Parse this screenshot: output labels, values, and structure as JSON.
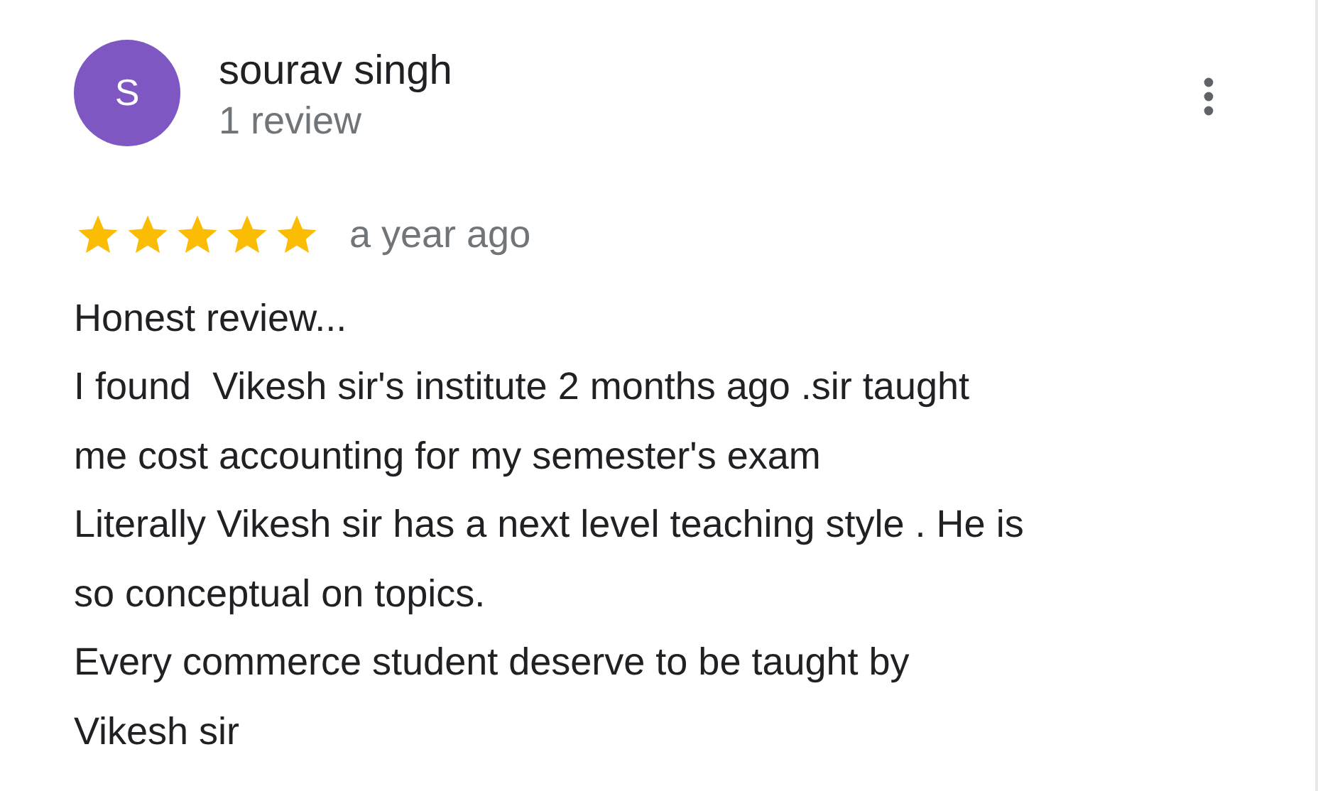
{
  "review": {
    "avatar_letter": "S",
    "author": "sourav singh",
    "review_count": "1 review",
    "stars": 5,
    "time": "a year ago",
    "lines": [
      "Honest review...",
      "I found  Vikesh sir's institute 2 months ago .sir taught",
      "me cost accounting for my semester's exam",
      "Literally Vikesh sir has a next level teaching style . He is",
      "so conceptual on topics.",
      "Every commerce student deserve to be taught by",
      "Vikesh sir"
    ]
  }
}
